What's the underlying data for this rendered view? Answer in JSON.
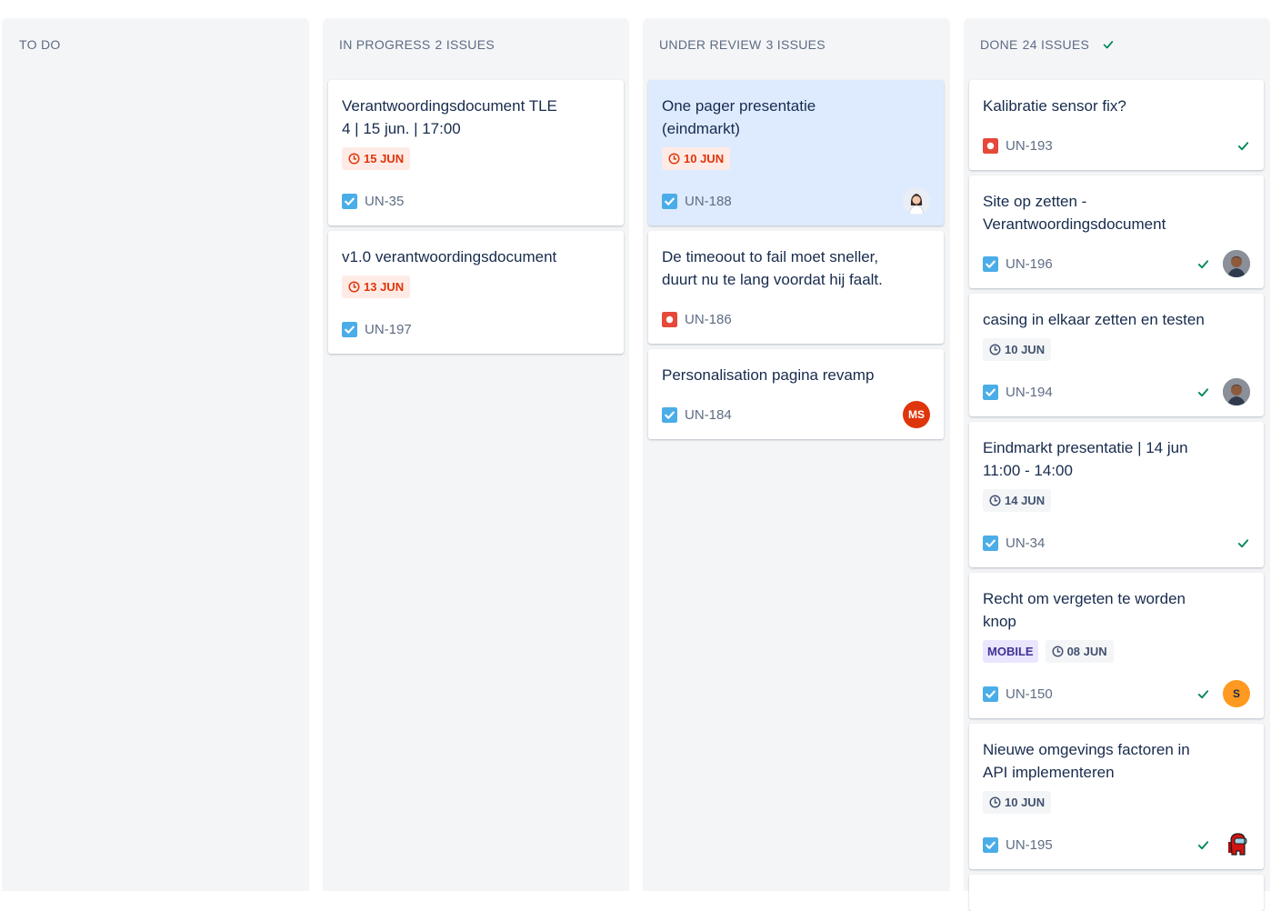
{
  "columns": [
    {
      "name": "TO DO",
      "count": ""
    },
    {
      "name": "IN PROGRESS",
      "count": "2 ISSUES"
    },
    {
      "name": "UNDER REVIEW",
      "count": "3 ISSUES"
    },
    {
      "name": "DONE",
      "count": "24 ISSUES"
    }
  ],
  "cards": {
    "un35": {
      "title": "Verantwoordingsdocument TLE\n4 | 15 jun. | 17:00",
      "due": "15 JUN",
      "key": "UN-35",
      "type": "task"
    },
    "un197": {
      "title": "v1.0 verantwoordingsdocument",
      "due": "13 JUN",
      "key": "UN-197",
      "type": "task"
    },
    "un188": {
      "title": "One pager presentatie\n(eindmarkt)",
      "due": "10 JUN",
      "key": "UN-188",
      "type": "task",
      "avatar": "woman-avatar"
    },
    "un186": {
      "title": "De timeoout to fail moet sneller,\nduurt nu te lang voordat hij faalt.",
      "key": "UN-186",
      "type": "bug"
    },
    "un184": {
      "title": "Personalisation pagina revamp",
      "key": "UN-184",
      "type": "task",
      "avatar_initials": "MS"
    },
    "un193": {
      "title": "Kalibratie sensor fix?",
      "key": "UN-193",
      "type": "bug"
    },
    "un196": {
      "title": "Site op zetten -\nVerantwoordingsdocument",
      "key": "UN-196",
      "type": "task",
      "avatar": "man-avatar"
    },
    "un194": {
      "title": "casing in elkaar zetten en testen",
      "due": "10 JUN",
      "key": "UN-194",
      "type": "task",
      "avatar": "man-avatar"
    },
    "un34": {
      "title": "Eindmarkt presentatie | 14 jun\n11:00 - 14:00",
      "due": "14 JUN",
      "key": "UN-34",
      "type": "task"
    },
    "un150": {
      "title": "Recht om vergeten te worden\nknop",
      "label": "MOBILE",
      "due": "08 JUN",
      "key": "UN-150",
      "type": "task",
      "avatar_initials": "S"
    },
    "un195": {
      "title": "Nieuwe omgevings factoren in\nAPI implementeren",
      "due": "10 JUN",
      "key": "UN-195",
      "type": "task",
      "avatar": "among-us-avatar"
    }
  },
  "colors": {
    "column_bg": "#f4f5f7",
    "selected_card": "#deebff",
    "overdue_text": "#de350b",
    "overdue_bg": "#ffebe6",
    "task_icon": "#4bade8",
    "bug_icon": "#e5493a",
    "done_check": "#00875a",
    "mobile_label_bg": "#eae6ff",
    "mobile_label_text": "#403294"
  },
  "icons": {
    "task": "checkbox-task-icon",
    "bug": "bug-dot-icon",
    "due": "clock-icon",
    "done": "checkmark-icon"
  }
}
